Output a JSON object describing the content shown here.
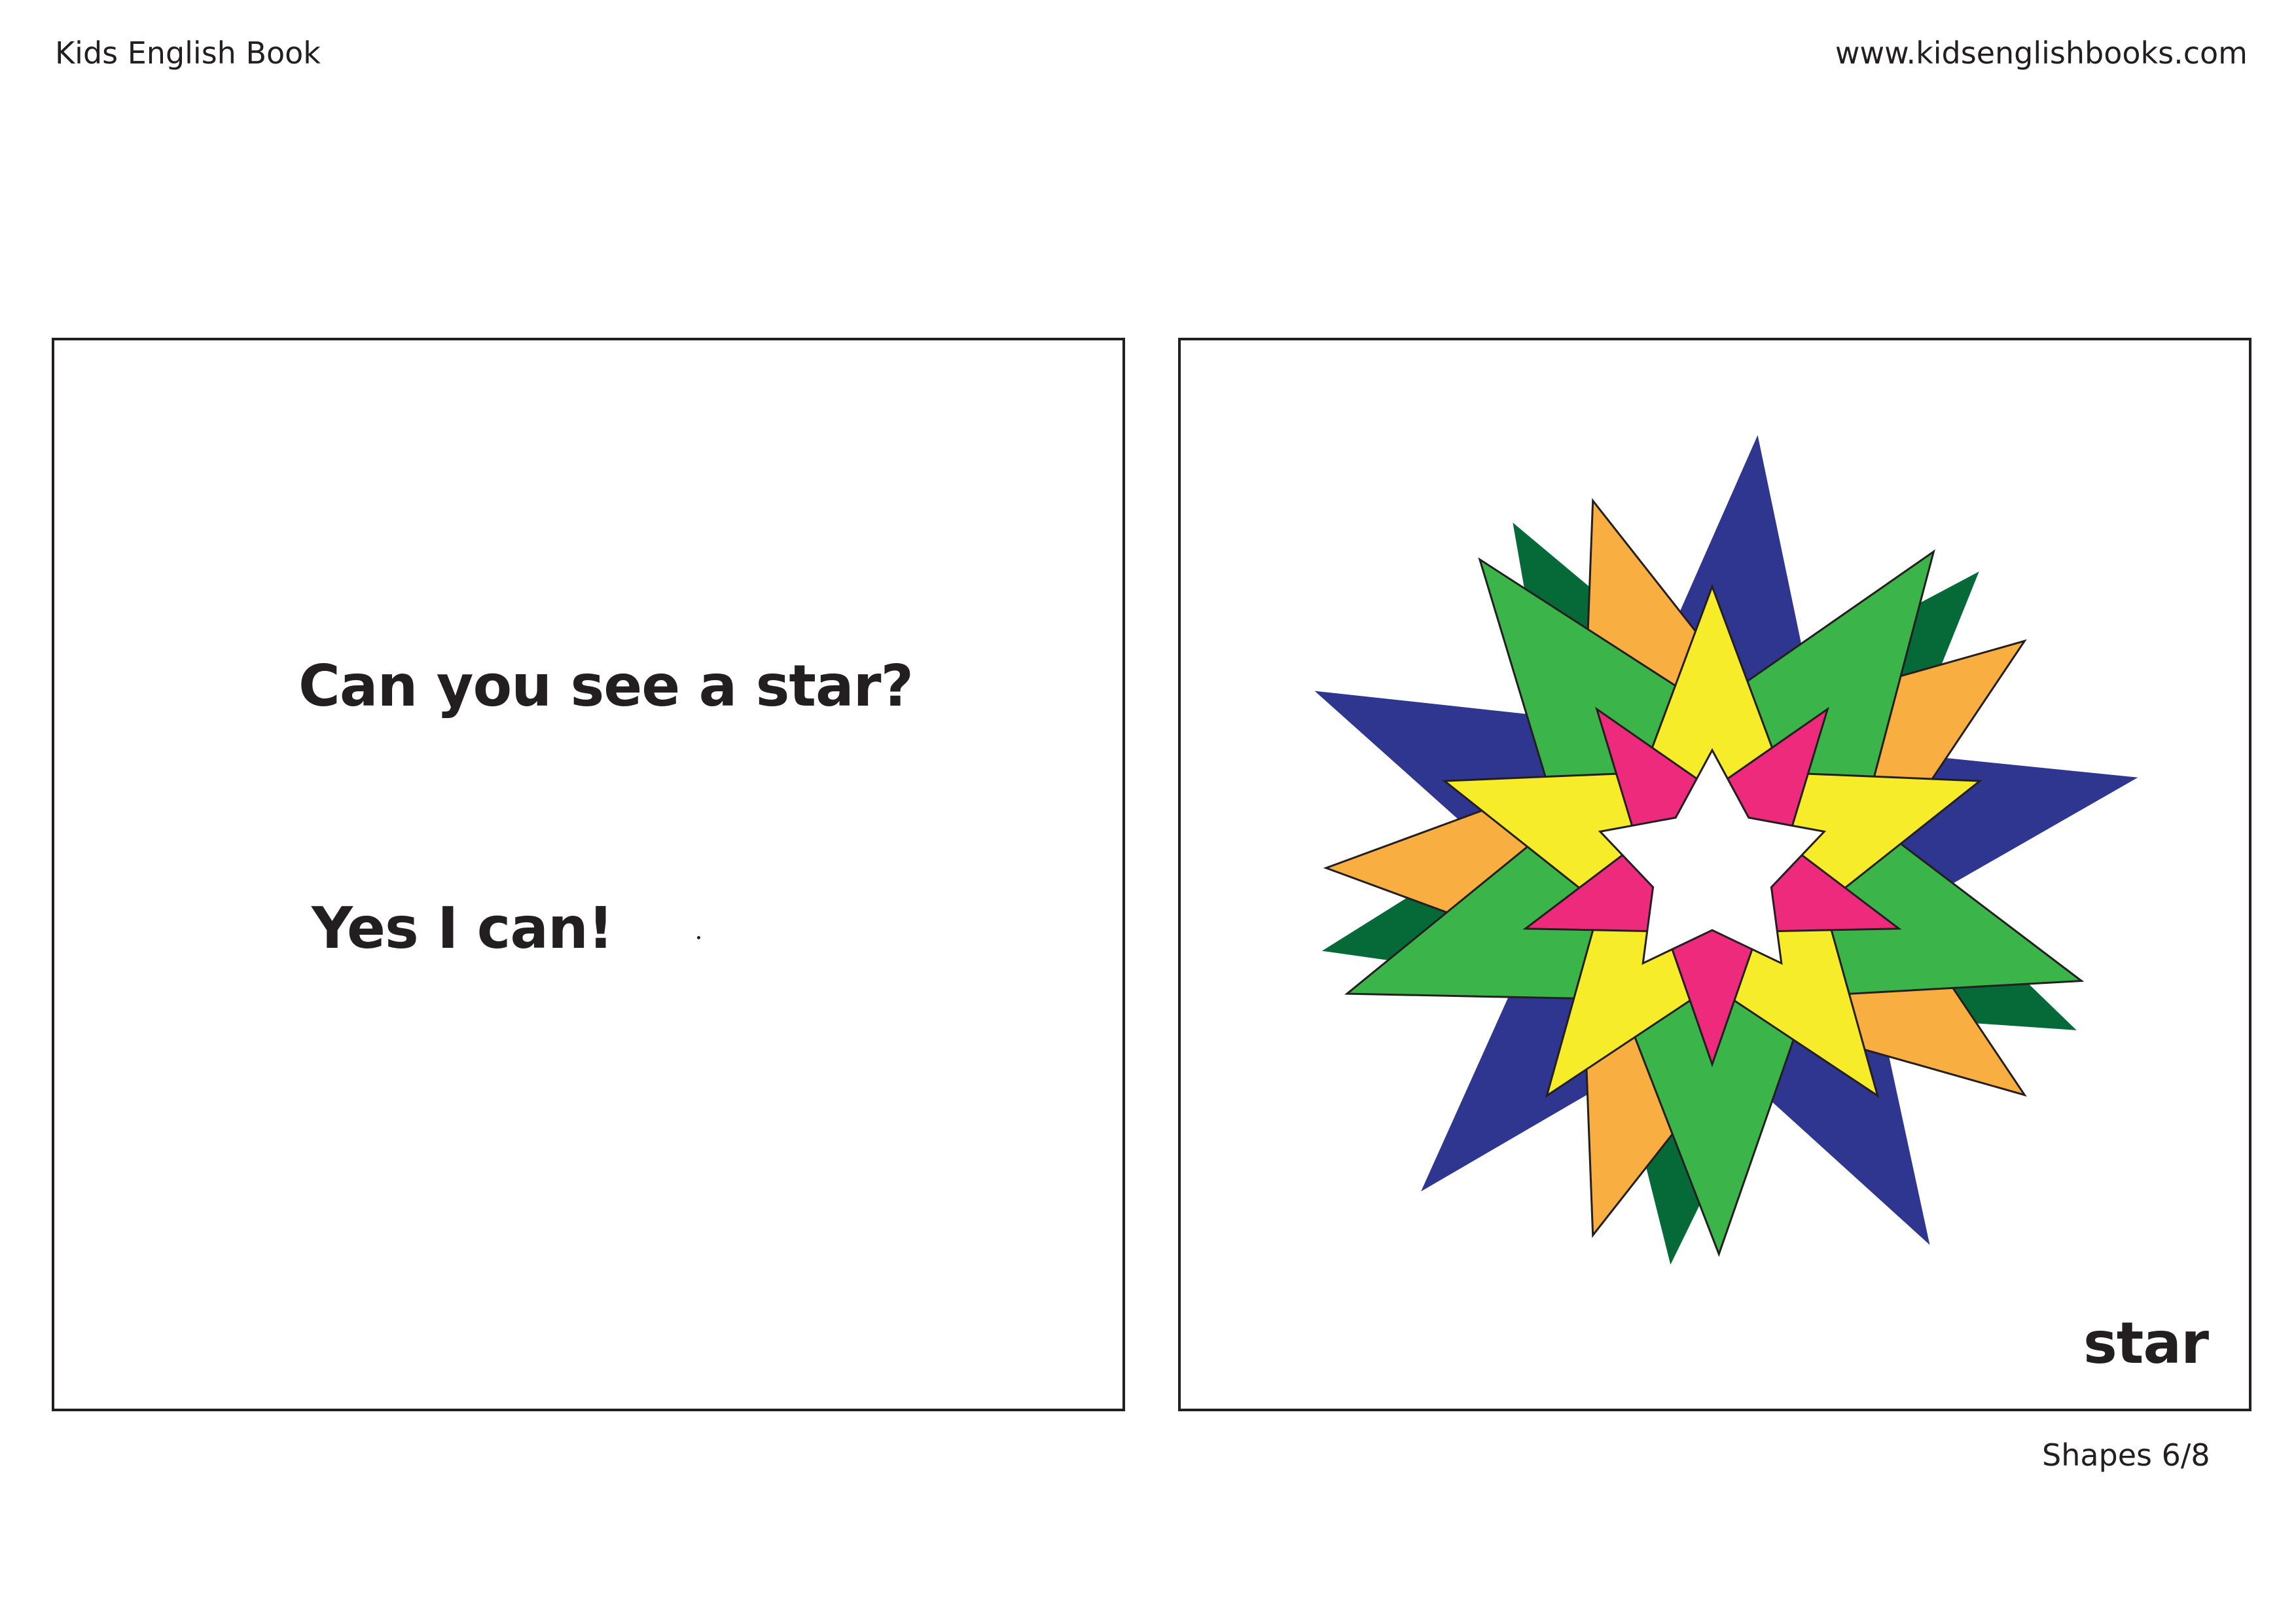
{
  "header": {
    "book_title": "Kids English Book",
    "website": "www.kidsenglishbooks.com"
  },
  "left_page": {
    "question": "Can you see a star?",
    "answer": "Yes I can!"
  },
  "right_page": {
    "illustration": "star-icon",
    "word": "star"
  },
  "footer": {
    "page_label": "Shapes 6/8"
  },
  "colors": {
    "outline": "#231f20",
    "navy": "#2e3690",
    "dark_green": "#066a38",
    "orange": "#f9ae41",
    "green": "#3bb54a",
    "yellow": "#f6ec2a",
    "pink": "#ed2a7b",
    "white": "#ffffff"
  }
}
